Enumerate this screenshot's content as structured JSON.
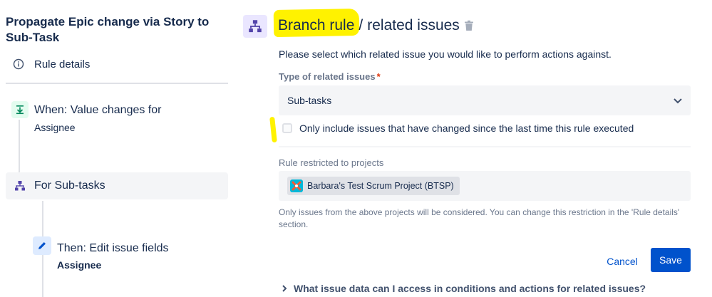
{
  "sidebar": {
    "rule_title": "Propagate Epic change via Story to Sub-Task",
    "rule_details_label": "Rule details",
    "trigger": {
      "title": "When: Value changes for",
      "subtitle": "Assignee"
    },
    "branch": {
      "title": "For Sub-tasks"
    },
    "action": {
      "title": "Then: Edit issue fields",
      "subtitle": "Assignee"
    }
  },
  "main": {
    "title_part1": "Branch rule",
    "title_sep": "/",
    "title_part2": "related issues",
    "description": "Please select which related issue you would like to perform actions against.",
    "type_label": "Type of related issues",
    "type_required": "*",
    "type_value": "Sub-tasks",
    "checkbox_label": "Only include issues that have changed since the last time this rule executed",
    "checkbox_checked": false,
    "projects_label": "Rule restricted to projects",
    "project_chip": "Barbara's Test Scrum Project (BTSP)",
    "help_text": "Only issues from the above projects will be considered. You can change this restriction in the 'Rule details' section.",
    "cancel_label": "Cancel",
    "save_label": "Save",
    "expander_label": "What issue data can I access in conditions and actions for related issues?"
  },
  "colors": {
    "primary": "#0052cc",
    "highlight": "#fff200",
    "branch_icon": "#5243aa",
    "trigger_icon": "#00875a"
  },
  "icons": {
    "rule_details": "info-icon",
    "trigger": "download-icon",
    "branch": "branch-icon",
    "action": "pencil-icon",
    "delete": "trash-icon",
    "select": "chevron-down-icon",
    "expander": "chevron-right-icon"
  }
}
